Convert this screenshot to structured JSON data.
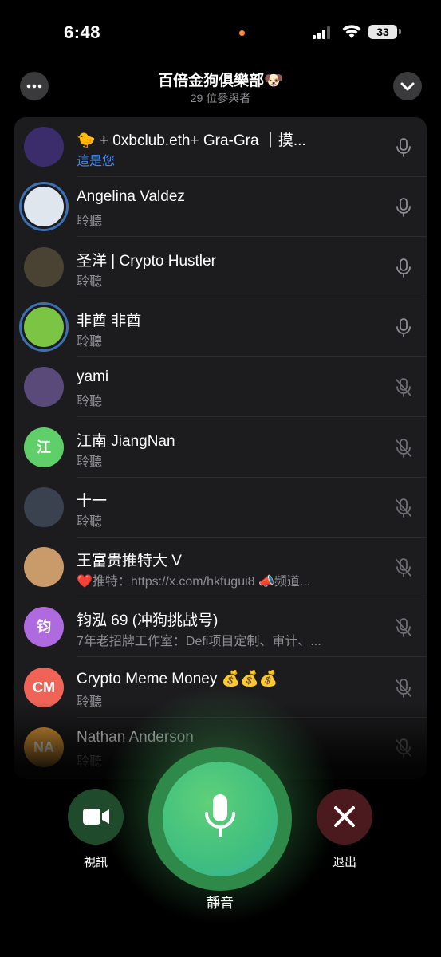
{
  "status_bar": {
    "time": "6:48",
    "battery": "33"
  },
  "header": {
    "title": "百倍金狗俱樂部🐶",
    "subtitle": "29 位參與者"
  },
  "participants": [
    {
      "name": "🐤 + 0xbclub.eth+ Gra-Gra ｜摸...",
      "status": "這是您",
      "avatar_text": "",
      "avatar_color": "#3b2d6b",
      "mic": "on"
    },
    {
      "name": "Angelina Valdez",
      "status": "聆聽",
      "avatar_text": "",
      "avatar_color": "#dfe6ee",
      "mic": "on"
    },
    {
      "name": "圣洋 | Crypto Hustler",
      "status": "聆聽",
      "avatar_text": "",
      "avatar_color": "#4a4232",
      "mic": "on"
    },
    {
      "name": "非酋 非酋",
      "status": "聆聽",
      "avatar_text": "",
      "avatar_color": "#7cc443",
      "mic": "on"
    },
    {
      "name": "yami",
      "status": "聆聽",
      "avatar_text": "",
      "avatar_color": "#5a4a7a",
      "mic": "off"
    },
    {
      "name": "江南 JiangNan",
      "status": "聆聽",
      "avatar_text": "江",
      "avatar_color": "#5fcf6a",
      "mic": "off"
    },
    {
      "name": "十一",
      "status": "聆聽",
      "avatar_text": "",
      "avatar_color": "#3a4250",
      "mic": "off"
    },
    {
      "name": "王富贵推特大 V",
      "status": "❤️推特：https://x.com/hkfugui8 📣频道...",
      "avatar_text": "",
      "avatar_color": "#c99a6a",
      "mic": "off"
    },
    {
      "name": "钧泓 69 (冲狗挑战号)",
      "status": "7年老招牌工作室：Defi项目定制、审计、...",
      "avatar_text": "钧",
      "avatar_color": "#b06ae0",
      "mic": "off"
    },
    {
      "name": "Crypto Meme Money 💰💰💰",
      "status": "聆聽",
      "avatar_text": "CM",
      "avatar_color": "#f06458",
      "mic": "off"
    },
    {
      "name": "Nathan Anderson",
      "status": "聆聽",
      "avatar_text": "NA",
      "avatar_color": "#e8a13a",
      "mic": "off"
    }
  ],
  "controls": {
    "video_label": "視訊",
    "mute_label": "靜音",
    "leave_label": "退出"
  },
  "colors": {
    "you_status": "#3d8bff",
    "mute_button": "#4fc97a",
    "leave_button": "#4a1a1e",
    "video_button": "#1f4a2c"
  }
}
